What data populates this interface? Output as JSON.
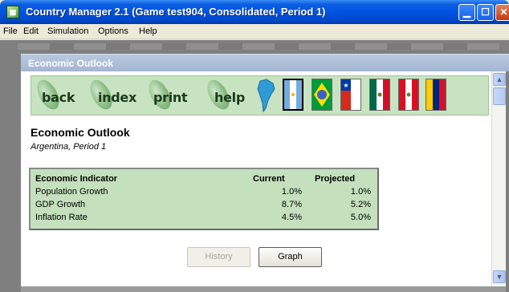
{
  "window": {
    "title": "Country Manager 2.1 (Game test904, Consolidated, Period 1)",
    "icon": "app-icon",
    "buttons": {
      "minimize": "minimize-icon",
      "maximize": "maximize-icon",
      "close": "close-icon"
    }
  },
  "menu": {
    "items": [
      "File",
      "Edit",
      "Simulation",
      "Options",
      "Help"
    ]
  },
  "panel": {
    "title": "Economic Outlook"
  },
  "nav": {
    "buttons": [
      "back",
      "index",
      "print",
      "help"
    ],
    "icons": [
      "map-icon",
      "argentina-flag-icon",
      "brazil-flag-icon",
      "chile-flag-icon",
      "mexico-flag-icon",
      "peru-flag-icon",
      "venezuela-flag-icon"
    ],
    "accent_color": "#c8e3c1"
  },
  "page": {
    "heading": "Economic Outlook",
    "subheading": "Argentina, Period 1"
  },
  "table": {
    "columns": [
      "Economic Indicator",
      "Current",
      "Projected"
    ],
    "rows": [
      {
        "indicator": "Population Growth",
        "current": "1.0%",
        "projected": "1.0%"
      },
      {
        "indicator": "GDP Growth",
        "current": "8.7%",
        "projected": "5.2%"
      },
      {
        "indicator": "Inflation Rate",
        "current": "4.5%",
        "projected": "5.0%"
      }
    ]
  },
  "actions": {
    "history_label": "History",
    "history_enabled": false,
    "graph_label": "Graph"
  }
}
